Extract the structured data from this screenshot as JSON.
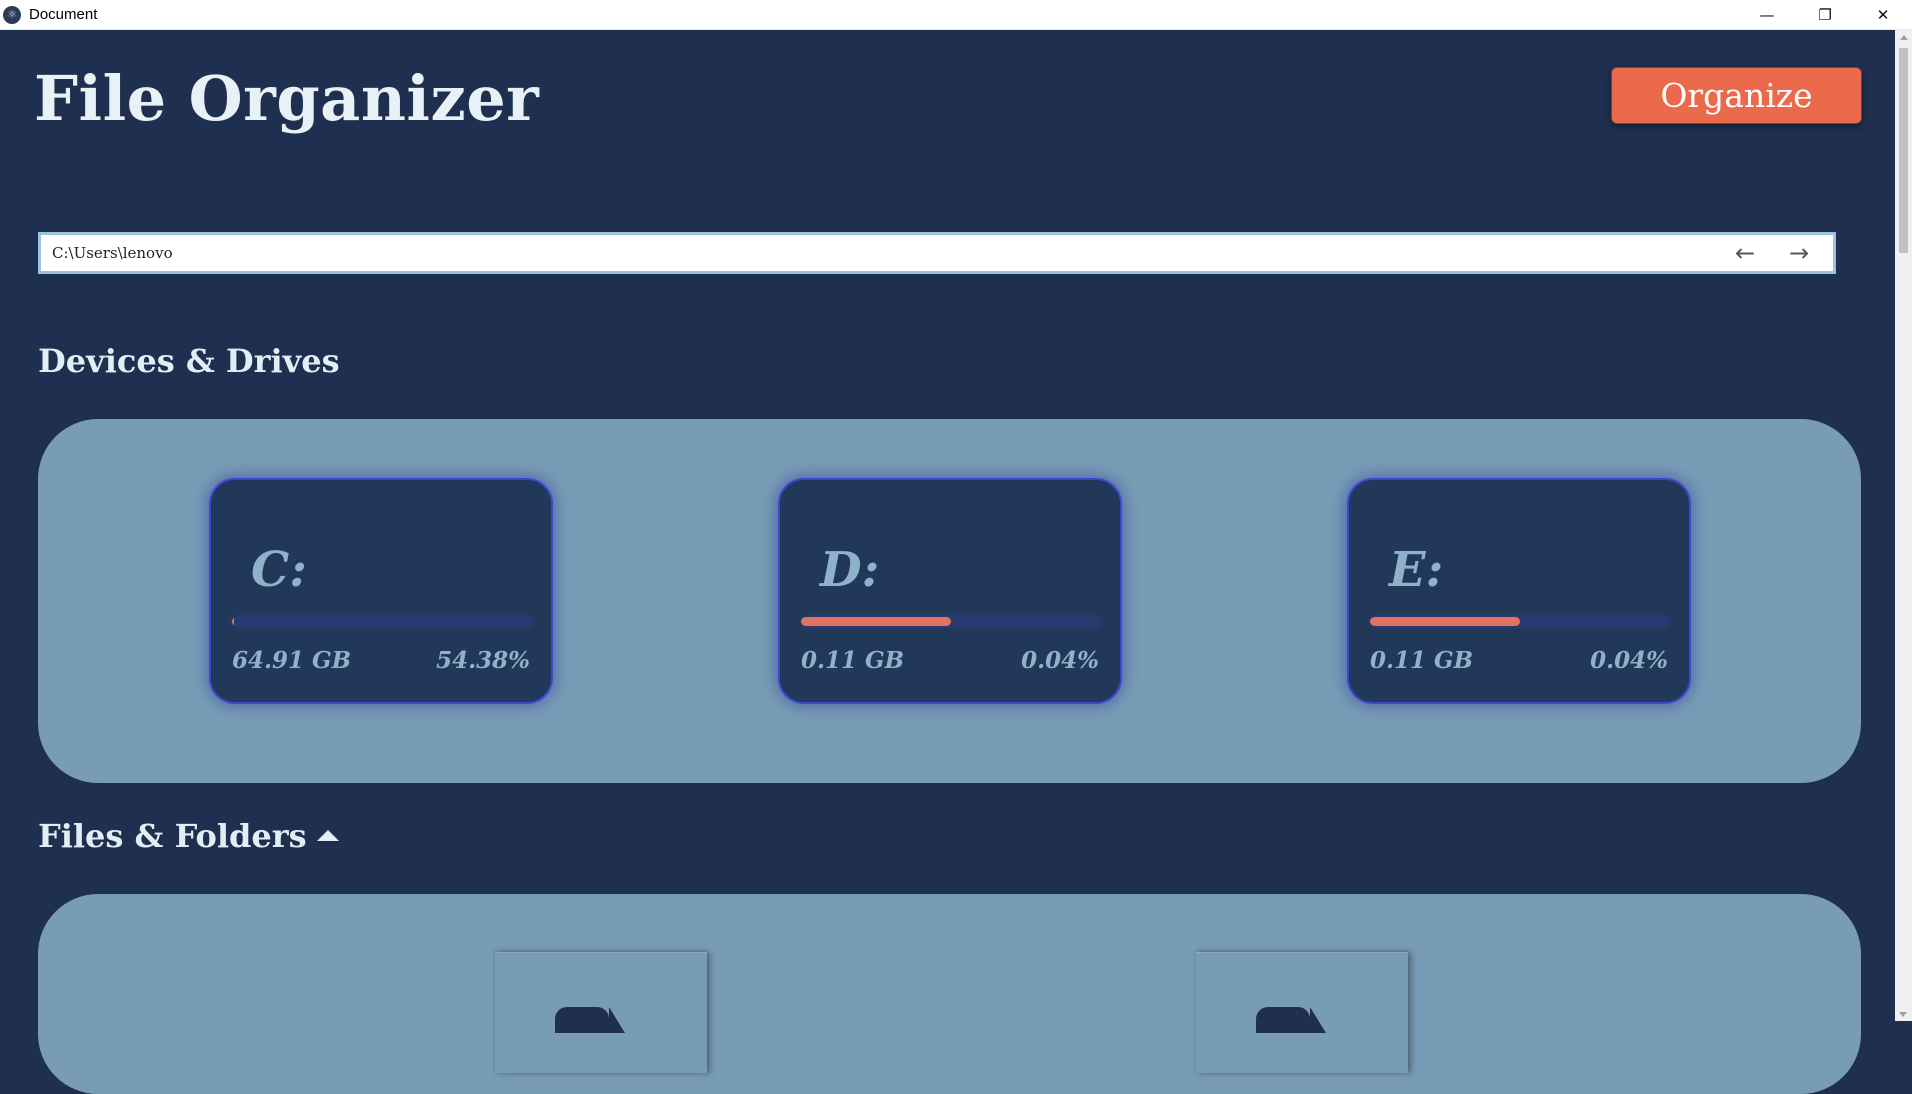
{
  "window": {
    "title": "Document",
    "app_icon": "electron-icon",
    "controls": {
      "minimize": "—",
      "restore": "❐",
      "close": "✕"
    }
  },
  "header": {
    "title": "File Organizer",
    "organize_label": "Organize"
  },
  "path_bar": {
    "value": "C:\\Users\\lenovo",
    "back_icon": "←",
    "forward_icon": "→"
  },
  "devices": {
    "heading": "Devices & Drives",
    "drives": [
      {
        "letter": "C:",
        "size": "64.91 GB",
        "percent": "54.38%",
        "bar_fill": 0.005
      },
      {
        "letter": "D:",
        "size": "0.11 GB",
        "percent": "0.04%",
        "bar_fill": 0.5
      },
      {
        "letter": "E:",
        "size": "0.11 GB",
        "percent": "0.04%",
        "bar_fill": 0.5
      }
    ]
  },
  "files": {
    "heading": "Files & Folders",
    "items": [
      {
        "icon": "folder-icon"
      },
      {
        "icon": "folder-icon"
      }
    ]
  },
  "colors": {
    "background": "#1f2f4f",
    "panel": "#789cb6",
    "card": "#223858",
    "accent": "#ea6a4b",
    "bar_fill": "#e2735f"
  }
}
